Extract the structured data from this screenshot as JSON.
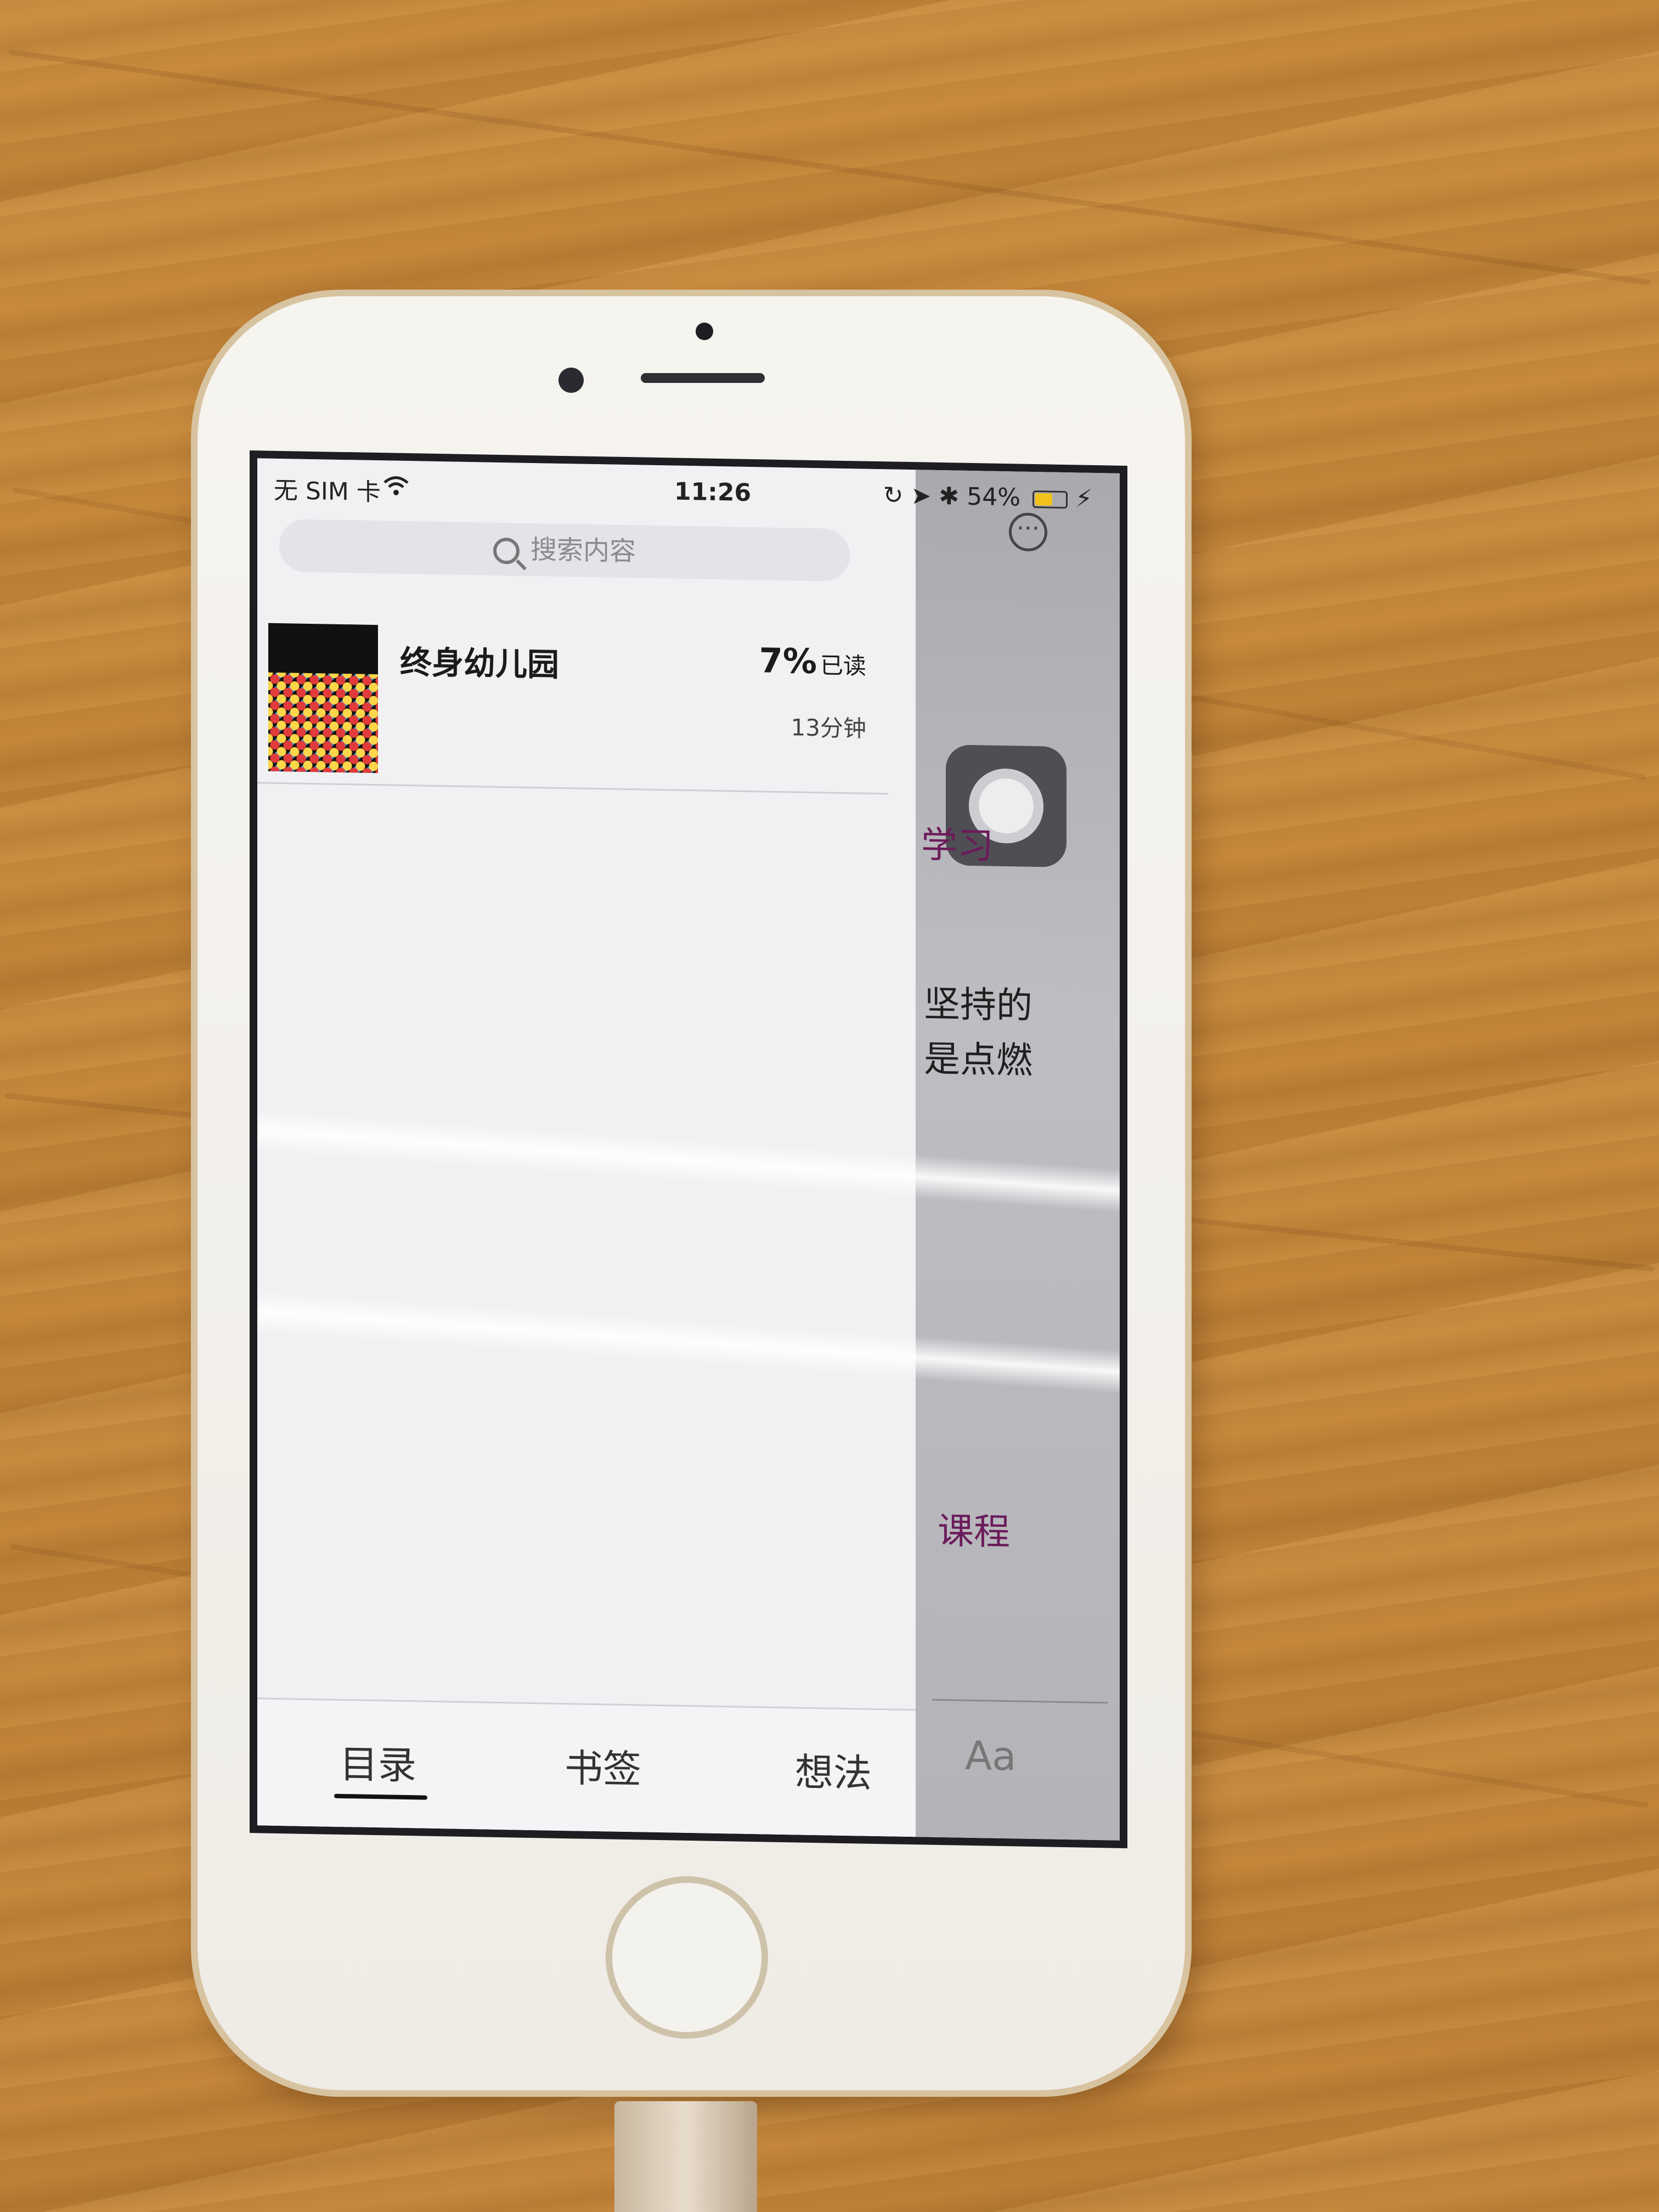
{
  "status_bar": {
    "carrier": "无 SIM 卡",
    "time": "11:26",
    "battery": "54%",
    "battery_level": 0.54,
    "icons": [
      "wifi-icon",
      "orientation-lock-icon",
      "location-icon",
      "bluetooth-icon",
      "battery-icon",
      "charging-icon"
    ]
  },
  "search": {
    "placeholder": "搜索内容"
  },
  "book": {
    "title": "终身幼儿园",
    "progress": "7%",
    "progress_suffix": "已读",
    "reading_time": "13分钟"
  },
  "tabs": [
    {
      "label": "目录",
      "active": true
    },
    {
      "label": "书签",
      "active": false
    },
    {
      "label": "想法",
      "active": false
    }
  ],
  "reader": {
    "font_button": "Aa",
    "more_icon": "more-icon",
    "text_fragments": [
      "学习",
      "坚持的",
      "是点燃",
      "课程"
    ],
    "link_color": "#6b1b5a"
  },
  "colors": {
    "wood": "#c98a3c",
    "battery_fill": "#f2c21b"
  }
}
